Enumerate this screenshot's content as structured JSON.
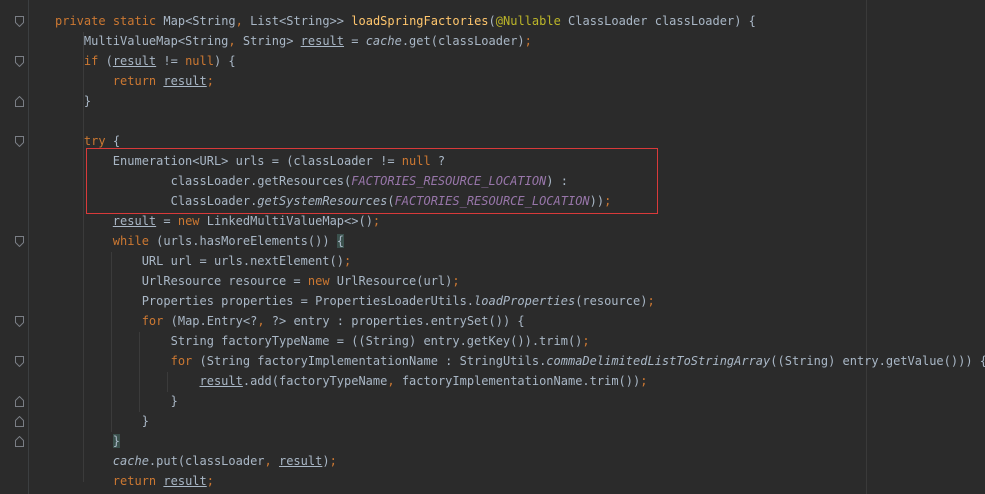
{
  "editor": {
    "language": "java",
    "lines": [
      "private static Map<String, List<String>> loadSpringFactories(@Nullable ClassLoader classLoader) {",
      "MultiValueMap<String, String> result = cache.get(classLoader);",
      "if (result != null) {",
      "return result;",
      "}",
      "",
      "try {",
      "Enumeration<URL> urls = (classLoader != null ?",
      "classLoader.getResources(FACTORIES_RESOURCE_LOCATION) :",
      "ClassLoader.getSystemResources(FACTORIES_RESOURCE_LOCATION));",
      "result = new LinkedMultiValueMap<>();",
      "while (urls.hasMoreElements()) {",
      "URL url = urls.nextElement();",
      "UrlResource resource = new UrlResource(url);",
      "Properties properties = PropertiesLoaderUtils.loadProperties(resource);",
      "for (Map.Entry<?, ?> entry : properties.entrySet()) {",
      "String factoryTypeName = ((String) entry.getKey()).trim();",
      "for (String factoryImplementationName : StringUtils.commaDelimitedListToStringArray((String) entry.getValue())) {",
      "result.add(factoryTypeName, factoryImplementationName.trim());",
      "}",
      "}",
      "}",
      "cache.put(classLoader, result);",
      "return result;"
    ]
  },
  "colors": {
    "background": "#2b2b2b",
    "text": "#a9b7c6",
    "keyword": "#cc7832",
    "method_declaration": "#ffc66d",
    "annotation": "#bbb529",
    "constant": "#9876aa",
    "highlight_box": "#d93a3a"
  },
  "icons": {
    "fold_marker": "fold-arrow-icon"
  }
}
